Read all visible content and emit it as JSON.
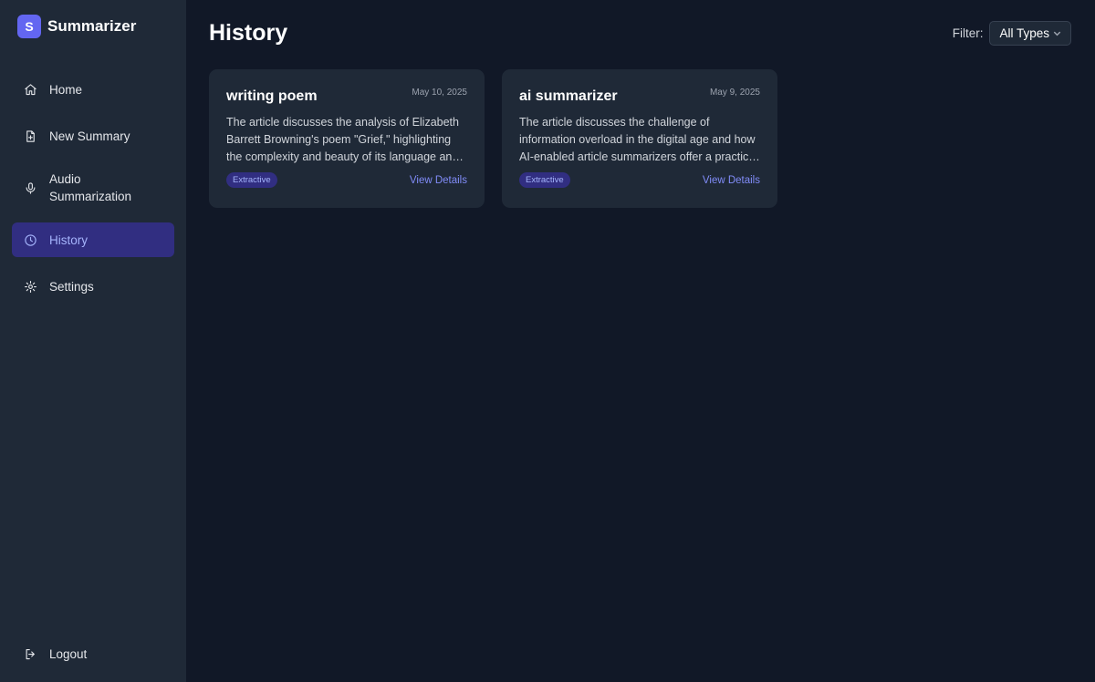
{
  "app": {
    "logo_letter": "S",
    "name": "Summarizer"
  },
  "sidebar": {
    "items": [
      {
        "label": "Home",
        "icon": "home-icon"
      },
      {
        "label": "New Summary",
        "icon": "file-plus-icon"
      },
      {
        "label": "Audio Summarization",
        "icon": "microphone-icon"
      },
      {
        "label": "History",
        "icon": "clock-icon",
        "active": true
      },
      {
        "label": "Settings",
        "icon": "gear-icon"
      }
    ],
    "logout": {
      "label": "Logout",
      "icon": "logout-icon"
    }
  },
  "page": {
    "title": "History"
  },
  "filter": {
    "label": "Filter:",
    "selected": "All Types"
  },
  "cards": [
    {
      "title": "writing poem",
      "date": "May 10, 2025",
      "text": "The article discusses the analysis of Elizabeth Barrett Browning's poem \"Grief,\" highlighting the complexity and beauty of its language and emotional depth.",
      "badge": "Extractive",
      "link": "View Details"
    },
    {
      "title": "ai summarizer",
      "date": "May 9, 2025",
      "text": "The article discusses the challenge of information overload in the digital age and how AI-enabled article summarizers offer a practical solution.",
      "badge": "Extractive",
      "link": "View Details"
    }
  ],
  "colors": {
    "background": "#111827",
    "sidebar": "#1f2937",
    "accent": "#6366f1",
    "active_bg": "#312e81",
    "active_text": "#a5b4fc",
    "link": "#818cf8"
  }
}
